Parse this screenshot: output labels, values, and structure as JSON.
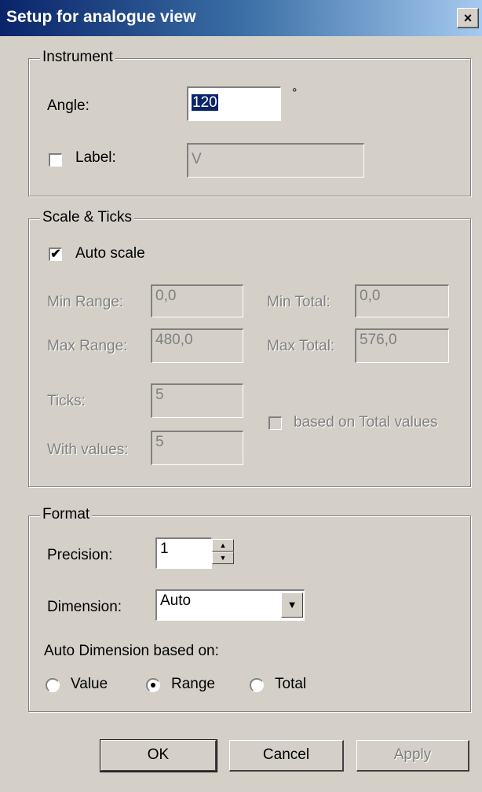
{
  "window": {
    "title": "Setup for analogue view",
    "close_glyph": "×"
  },
  "instrument": {
    "legend": "Instrument",
    "angle_label": "Angle:",
    "angle_value": "120",
    "angle_unit": "°",
    "label_checkbox_label": "Label:",
    "label_checked": false,
    "label_value": "V"
  },
  "scale": {
    "legend": "Scale & Ticks",
    "auto_scale_label": "Auto scale",
    "auto_scale_checked": true,
    "min_range_label": "Min Range:",
    "min_range_value": "0,0",
    "max_range_label": "Max Range:",
    "max_range_value": "480,0",
    "min_total_label": "Min Total:",
    "min_total_value": "0,0",
    "max_total_label": "Max Total:",
    "max_total_value": "576,0",
    "ticks_label": "Ticks:",
    "ticks_value": "5",
    "with_values_label": "With values:",
    "with_values_value": "5",
    "based_on_total_label": "based on Total values"
  },
  "format": {
    "legend": "Format",
    "precision_label": "Precision:",
    "precision_value": "1",
    "dimension_label": "Dimension:",
    "dimension_value": "Auto",
    "auto_dimension_label": "Auto Dimension based on:",
    "radio_value": "Value",
    "radio_range": "Range",
    "radio_total": "Total",
    "selected_radio": "Range"
  },
  "buttons": {
    "ok": "OK",
    "cancel": "Cancel",
    "apply": "Apply"
  },
  "icons": {
    "check": "✔",
    "spin_up": "▲",
    "spin_down": "▼",
    "dropdown": "▼"
  },
  "colors": {
    "titlebar_start": "#0a246a",
    "titlebar_end": "#a6caf0",
    "dialog_bg": "#d4d0c8"
  }
}
